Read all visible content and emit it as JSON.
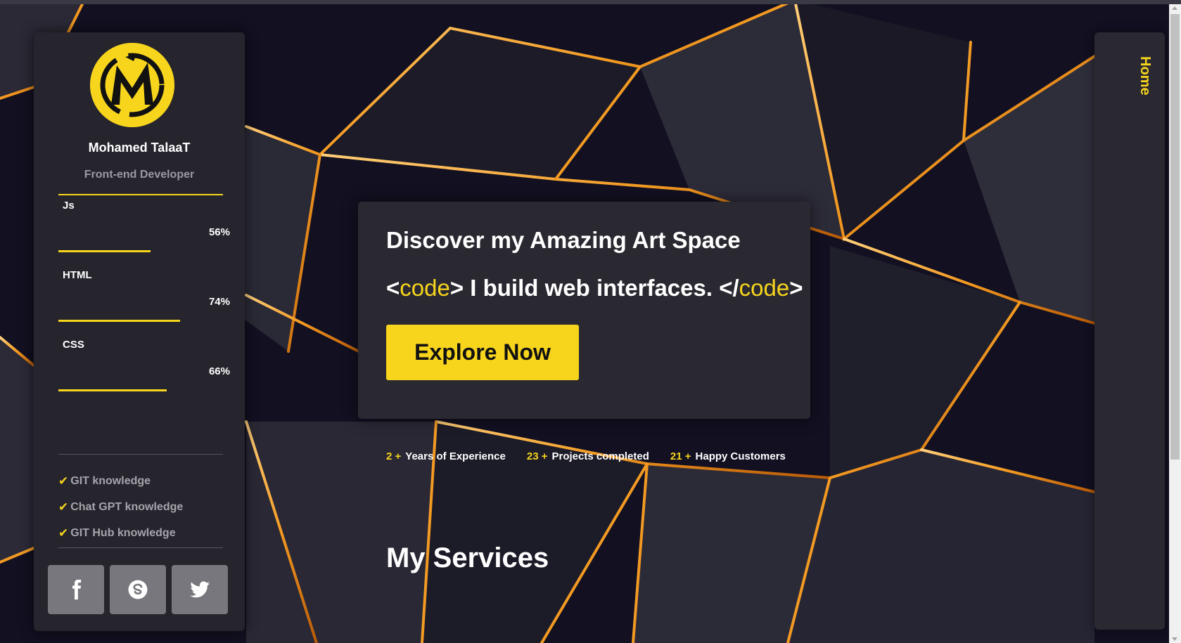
{
  "profile": {
    "name": "Mohamed TalaaT",
    "role": "Front-end Developer",
    "logo_letter": "M"
  },
  "skills": [
    {
      "label": "Js",
      "percent_text": "56%",
      "level": 0.56
    },
    {
      "label": "HTML",
      "percent_text": "74%",
      "level": 0.74
    },
    {
      "label": "CSS",
      "percent_text": "66%",
      "level": 0.66
    }
  ],
  "knowledge": [
    {
      "check": "✔",
      "label": "GIT knowledge"
    },
    {
      "check": "✔",
      "label": "Chat GPT knowledge"
    },
    {
      "check": "✔",
      "label": "GIT Hub knowledge"
    }
  ],
  "socials": [
    "facebook-icon",
    "skype-icon",
    "twitter-icon"
  ],
  "hero": {
    "title": "Discover my Amazing Art Space",
    "sub_open_lt": "<",
    "sub_kw1": "code",
    "sub_mid": "> I build web interfaces. </",
    "sub_kw2": "code",
    "sub_close_gt": ">",
    "button": "Explore Now"
  },
  "stats": [
    {
      "num": "2 +",
      "label": "Years of Experience"
    },
    {
      "num": "23 +",
      "label": "Projects completed"
    },
    {
      "num": "21 +",
      "label": "Happy Customers"
    }
  ],
  "section_title": "My Services",
  "nav": {
    "home": "Home"
  },
  "colors": {
    "accent": "#f7d51d",
    "panel": "#26252d",
    "background": "#0f0d1a"
  }
}
